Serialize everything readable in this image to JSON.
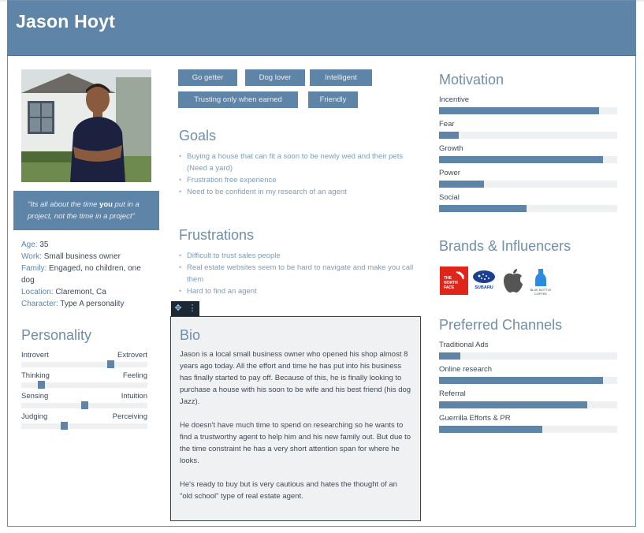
{
  "persona": {
    "name": "Jason Hoyt",
    "quote_pre": "\"Its all about the time ",
    "quote_bold": "you",
    "quote_post": " put in a project, not the time in a project\"",
    "facts": [
      {
        "key": "Age:",
        "value": " 35"
      },
      {
        "key": "Work:",
        "value": " Small business owner"
      },
      {
        "key": "Family:",
        "value": " Engaged, no children, one dog"
      },
      {
        "key": "Location:",
        "value": " Claremont, Ca"
      },
      {
        "key": "Character:",
        "value": " Type A personality"
      }
    ]
  },
  "personality": {
    "title": "Personality",
    "scales": [
      {
        "left": "Introvert",
        "right": "Extrovert",
        "value": 0.72
      },
      {
        "left": "Thinking",
        "right": "Feeling",
        "value": 0.14
      },
      {
        "left": "Sensing",
        "right": "Intuition",
        "value": 0.5
      },
      {
        "left": "Judging",
        "right": "Perceiving",
        "value": 0.33
      }
    ]
  },
  "tags": [
    "Go getter",
    "Dog lover",
    "Intelligent",
    "Trusting only when earned",
    "Friendly"
  ],
  "goals": {
    "title": "Goals",
    "items": [
      "Buying a house that can fit a soon to be newly wed and their pets (Need a yard)",
      "Frustration free experience",
      "Need to be confident in my research of an agent"
    ]
  },
  "frustrations": {
    "title": "Frustrations",
    "items": [
      "Difficult to trust sales people",
      "Real estate websites seem to be hard to navigate and make you call them",
      "Hard to find an agent"
    ]
  },
  "toolbar": {
    "move_glyph": "✥",
    "more_glyph": "⋮"
  },
  "bio": {
    "title": "Bio",
    "paragraphs": [
      "Jason is a local small business owner who opened his shop almost 8 years ago today. All the effort and time he has put into his business has finally started to pay off. Because of this, he is finally looking to purchase a house with his soon to be wife and his best friend (his dog Jazz).",
      "He doesn't have much time to spend on researching so he wants to find a trustworthy agent to help him and his new family out. But due to the time constraint he has a very short attention span for where he looks.",
      "He's ready to buy but is very cautious and hates the thought of an  \"old school\" type of real estate agent."
    ]
  },
  "motivation": {
    "title": "Motivation",
    "items": [
      {
        "label": "Incentive",
        "value": 0.9
      },
      {
        "label": "Fear",
        "value": 0.11
      },
      {
        "label": "Growth",
        "value": 0.92
      },
      {
        "label": "Power",
        "value": 0.25
      },
      {
        "label": "Social",
        "value": 0.49
      }
    ]
  },
  "brands": {
    "title": "Brands & Influencers",
    "logos": [
      {
        "name": "The North Face",
        "text": "THE NORTH FACE",
        "color": "#e0251b"
      },
      {
        "name": "Subaru",
        "text": "SUBARU",
        "color": "#1c3f94"
      },
      {
        "name": "Apple",
        "text": "",
        "color": "#555555"
      },
      {
        "name": "Blue Bottle Coffee",
        "text": "BLUE BOTTLE COFFEE",
        "color": "#2a8be0"
      }
    ]
  },
  "channels": {
    "title": "Preferred Channels",
    "items": [
      {
        "label": "Traditional Ads",
        "value": 0.12
      },
      {
        "label": "Online research",
        "value": 0.92
      },
      {
        "label": "Referral",
        "value": 0.83
      },
      {
        "label": "Guerrilla Efforts & PR",
        "value": 0.58
      }
    ]
  },
  "colors": {
    "accent": "#5e84a8",
    "track": "#eef0f2",
    "text": "#3d4a59"
  }
}
